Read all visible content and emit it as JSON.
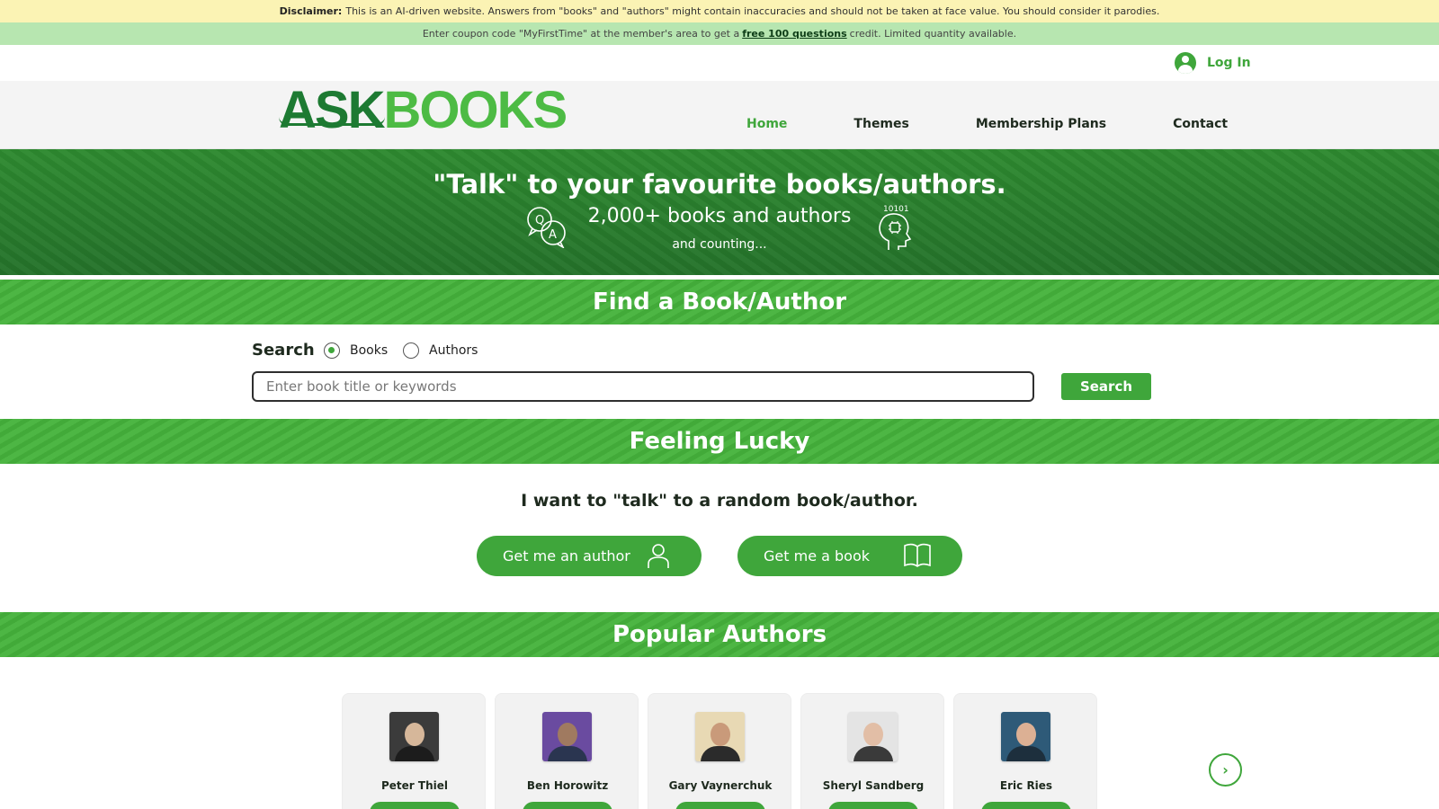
{
  "disclaimer": {
    "label": "Disclaimer:",
    "text": "This is an AI-driven website. Answers from \"books\" and \"authors\" might contain inaccuracies and should not be taken at face value. You should consider it parodies."
  },
  "coupon": {
    "before": "Enter coupon code \"MyFirstTime\" at the member's area to get a",
    "link": "free 100 questions",
    "after": "credit. Limited quantity available."
  },
  "login": {
    "label": "Log In",
    "icon": "user-avatar-icon"
  },
  "logo": {
    "ask": "ASK",
    "books": "BOOKS"
  },
  "nav": [
    {
      "label": "Home",
      "active": true
    },
    {
      "label": "Themes",
      "active": false
    },
    {
      "label": "Membership Plans",
      "active": false
    },
    {
      "label": "Contact",
      "active": false
    }
  ],
  "hero": {
    "title": "\"Talk\" to your favourite books/authors.",
    "subtitle": "2,000+ books and authors",
    "subtitle2": "and counting...",
    "binary": "10101",
    "icons": [
      "qa-bubbles-icon",
      "brain-head-icon"
    ]
  },
  "find_section": {
    "title": "Find a Book/Author",
    "search_label": "Search",
    "radio_books": "Books",
    "radio_authors": "Authors",
    "selected": "Books",
    "placeholder": "Enter book title or keywords",
    "value": "",
    "button": "Search"
  },
  "lucky_section": {
    "title": "Feeling Lucky",
    "text": "I want to \"talk\" to a random book/author.",
    "author_button": "Get me an author",
    "book_button": "Get me a book"
  },
  "authors_section": {
    "title": "Popular Authors",
    "authors": [
      {
        "name": "Peter Thiel"
      },
      {
        "name": "Ben Horowitz"
      },
      {
        "name": "Gary Vaynerchuk"
      },
      {
        "name": "Sheryl Sandberg"
      },
      {
        "name": "Eric Ries"
      }
    ]
  },
  "colors": {
    "brand_green": "#3fa63b",
    "dark_green": "#1d7a32",
    "disclaimer_bg": "#fbf3b4",
    "coupon_bg": "#b7e6b0"
  }
}
